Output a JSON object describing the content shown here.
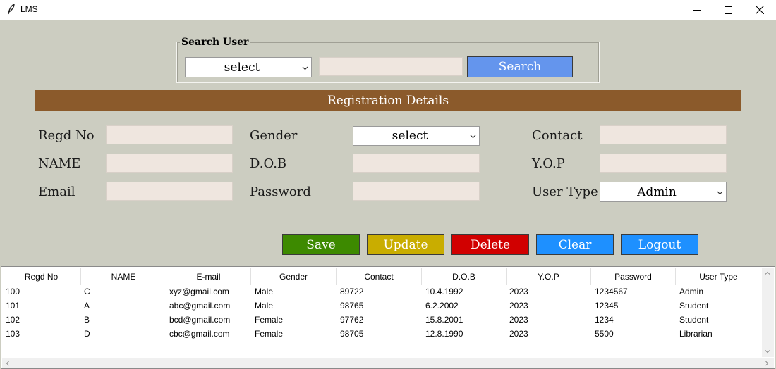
{
  "window": {
    "title": "LMS"
  },
  "search": {
    "legend": "Search User",
    "field_value": "select",
    "query_value": "",
    "button_label": "Search"
  },
  "section_title": "Registration Details",
  "form": {
    "regd_no_label": "Regd No",
    "name_label": "NAME",
    "email_label": "Email",
    "gender_label": "Gender",
    "gender_value": "select",
    "dob_label": "D.O.B",
    "password_label": "Password",
    "contact_label": "Contact",
    "yop_label": "Y.O.P",
    "user_type_label": "User Type",
    "user_type_value": "Admin"
  },
  "buttons": {
    "save": "Save",
    "update": "Update",
    "delete": "Delete",
    "clear": "Clear",
    "logout": "Logout"
  },
  "colors": {
    "background": "#cccdc1",
    "banner": "#8b5a2b",
    "search_button": "#6495ed",
    "save": "#3d8a00",
    "update": "#c9ad00",
    "delete": "#d10000",
    "clear": "#1e90ff",
    "logout": "#1e90ff"
  },
  "table": {
    "columns": [
      "Regd No",
      "NAME",
      "E-mail",
      "Gender",
      "Contact",
      "D.O.B",
      "Y.O.P",
      "Password",
      "User Type"
    ],
    "rows": [
      [
        "100",
        "C",
        "xyz@gmail.com",
        "Male",
        "89722",
        "10.4.1992",
        "2023",
        "1234567",
        "Admin"
      ],
      [
        "101",
        "A",
        "abc@gmail.com",
        "Male",
        "98765",
        "6.2.2002",
        "2023",
        "12345",
        "Student"
      ],
      [
        "102",
        "B",
        "bcd@gmail.com",
        "Female",
        "97762",
        "15.8.2001",
        "2023",
        "1234",
        "Student"
      ],
      [
        "103",
        "D",
        "cbc@gmail.com",
        "Female",
        "98705",
        "12.8.1990",
        "2023",
        "5500",
        "Librarian"
      ]
    ]
  },
  "icons": {
    "app": "feather-icon",
    "minimize": "minimize-icon",
    "maximize": "maximize-icon",
    "close": "close-icon",
    "dropdown": "chevron-down-icon"
  }
}
